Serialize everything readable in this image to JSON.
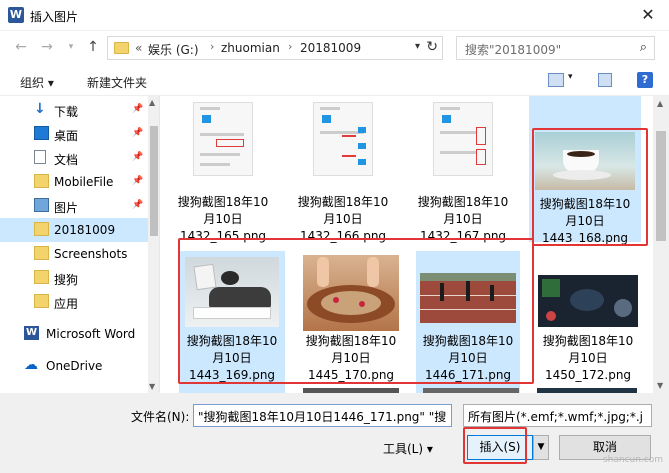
{
  "window": {
    "title": "插入图片",
    "app_icon": "W"
  },
  "address": {
    "prefix": "«",
    "segments": [
      "娱乐 (G:)",
      "zhuomian",
      "20181009"
    ],
    "search_placeholder": "搜索\"20181009\""
  },
  "toolbar": {
    "organize": "组织 ▾",
    "new_folder": "新建文件夹"
  },
  "sidebar": {
    "items": [
      {
        "label": "下载",
        "icon": "download-icon",
        "pinned": true
      },
      {
        "label": "桌面",
        "icon": "desktop-icon",
        "pinned": true
      },
      {
        "label": "文档",
        "icon": "document-icon",
        "pinned": true
      },
      {
        "label": "MobileFile",
        "icon": "folder-icon",
        "pinned": true
      },
      {
        "label": "图片",
        "icon": "pictures-icon",
        "pinned": true
      },
      {
        "label": "20181009",
        "icon": "folder-icon",
        "pinned": false
      },
      {
        "label": "Screenshots",
        "icon": "folder-icon",
        "pinned": false
      },
      {
        "label": "搜狗",
        "icon": "folder-icon",
        "pinned": false
      },
      {
        "label": "应用",
        "icon": "folder-icon",
        "pinned": false
      },
      {
        "label": "Microsoft Word",
        "icon": "word-icon",
        "pinned": false
      },
      {
        "label": "OneDrive",
        "icon": "onedrive-icon",
        "pinned": false
      }
    ]
  },
  "files": [
    {
      "line1": "搜狗截图18年10",
      "line2": "月10日",
      "line3": "1432_165.png",
      "selected": false
    },
    {
      "line1": "搜狗截图18年10",
      "line2": "月10日",
      "line3": "1432_166.png",
      "selected": false
    },
    {
      "line1": "搜狗截图18年10",
      "line2": "月10日",
      "line3": "1432_167.png",
      "selected": false
    },
    {
      "line1": "搜狗截图18年10",
      "line2": "月10日",
      "line3": "1443_168.png",
      "selected": true
    },
    {
      "line1": "搜狗截图18年10",
      "line2": "月10日",
      "line3": "1443_169.png",
      "selected": true
    },
    {
      "line1": "搜狗截图18年10",
      "line2": "月10日",
      "line3": "1445_170.png",
      "selected": true
    },
    {
      "line1": "搜狗截图18年10",
      "line2": "月10日",
      "line3": "1446_171.png",
      "selected": true
    },
    {
      "line1": "搜狗截图18年10",
      "line2": "月10日",
      "line3": "1450_172.png",
      "selected": false
    }
  ],
  "bottom": {
    "filename_label": "文件名(N):",
    "filename_value": "\"搜狗截图18年10月10日1446_171.png\" \"搜",
    "filetype_value": "所有图片(*.emf;*.wmf;*.jpg;*.j",
    "tools": "工具(L)  ▾",
    "insert": "插入(S)",
    "split_arrow": "▼",
    "cancel": "取消"
  },
  "watermark": "shancun.com",
  "colors": {
    "selection": "#cce8ff",
    "highlight": "#e23535",
    "accent": "#0078d7"
  }
}
